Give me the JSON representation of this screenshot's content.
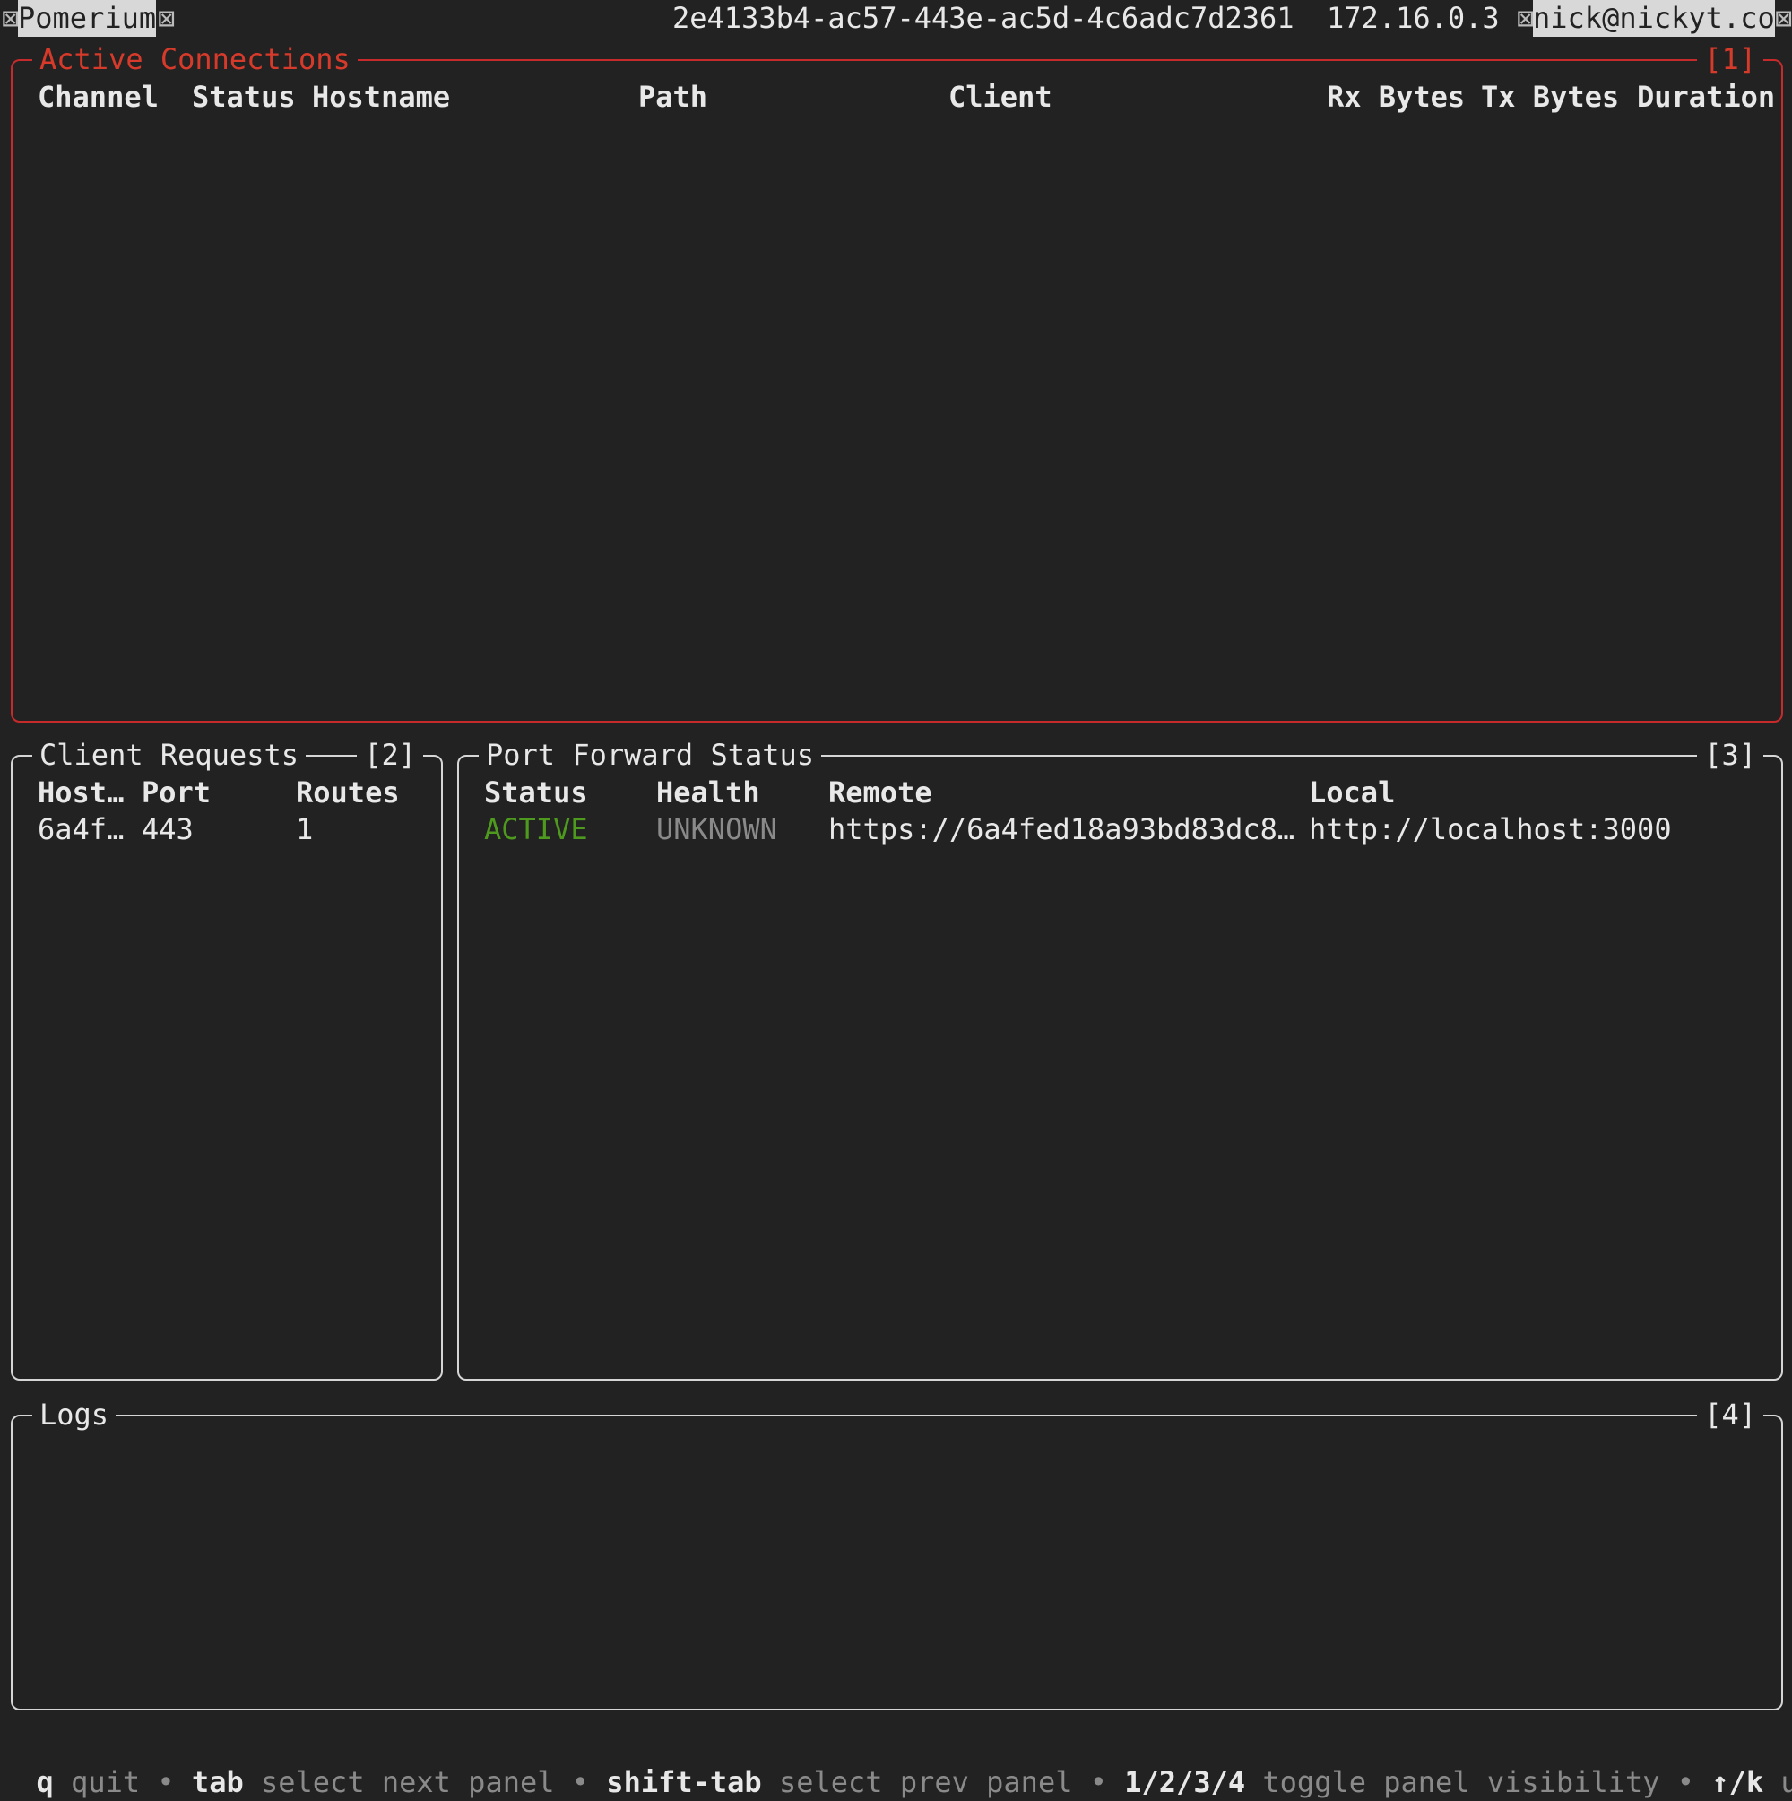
{
  "topbar": {
    "app_name": "Pomerium",
    "session_id": "2e4133b4-ac57-443e-ac5d-4c6adc7d2361",
    "ip": "172.16.0.3",
    "user": "nick@nickyt.co",
    "glyph": "⊠"
  },
  "active_connections": {
    "title": "Active Connections",
    "index": "[1]",
    "columns": [
      "Channel",
      "Status",
      "Hostname",
      "Path",
      "Client",
      "Rx Bytes",
      "Tx Bytes",
      "Duration"
    ],
    "rows": []
  },
  "client_requests": {
    "title": "Client Requests",
    "index": "[2]",
    "columns": [
      "Host…",
      "Port",
      "Routes"
    ],
    "rows": [
      {
        "host": "6a4f…",
        "port": "443",
        "routes": "1"
      }
    ]
  },
  "port_forward": {
    "title": "Port Forward Status",
    "index": "[3]",
    "columns": [
      "Status",
      "Health",
      "Remote",
      "Local"
    ],
    "rows": [
      {
        "status": "ACTIVE",
        "health": "UNKNOWN",
        "remote": "https://6a4fed18a93bd83dc8…",
        "local": "http://localhost:3000"
      }
    ]
  },
  "logs": {
    "title": "Logs",
    "index": "[4]",
    "lines": []
  },
  "footer": {
    "items": [
      {
        "key": "q",
        "desc": "quit"
      },
      {
        "key": "tab",
        "desc": "select next panel"
      },
      {
        "key": "shift-tab",
        "desc": "select prev panel"
      },
      {
        "key": "1/2/3/4",
        "desc": "toggle panel visibility"
      },
      {
        "key": "↑/k",
        "desc": "up"
      }
    ],
    "separator": "•"
  },
  "colors": {
    "background": "#222222",
    "active_border": "#c62a2a",
    "status_active": "#4e9a1e",
    "dim_text": "#8a8a8a"
  }
}
